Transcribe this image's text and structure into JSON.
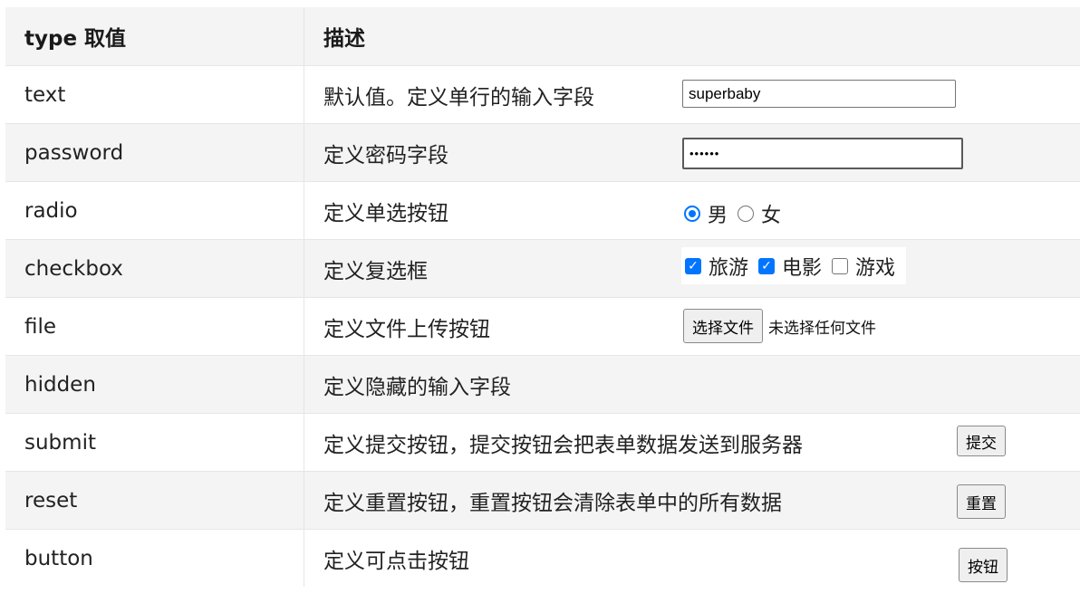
{
  "header": {
    "col_type": "type 取值",
    "col_desc": "描述"
  },
  "rows": [
    {
      "type": "text",
      "desc": "默认值。定义单行的输入字段",
      "value": "superbaby"
    },
    {
      "type": "password",
      "desc": "定义密码字段",
      "masked_value": "••••••"
    },
    {
      "type": "radio",
      "desc": "定义单选按钮",
      "options": [
        {
          "label": "男",
          "checked": true
        },
        {
          "label": "女",
          "checked": false
        }
      ]
    },
    {
      "type": "checkbox",
      "desc": "定义复选框",
      "options": [
        {
          "label": "旅游",
          "checked": true
        },
        {
          "label": "电影",
          "checked": true
        },
        {
          "label": "游戏",
          "checked": false
        }
      ]
    },
    {
      "type": "file",
      "desc": "定义文件上传按钮",
      "button_label": "选择文件",
      "status": "未选择任何文件"
    },
    {
      "type": "hidden",
      "desc": "定义隐藏的输入字段"
    },
    {
      "type": "submit",
      "desc": "定义提交按钮，提交按钮会把表单数据发送到服务器",
      "button_label": "提交"
    },
    {
      "type": "reset",
      "desc": "定义重置按钮，重置按钮会清除表单中的所有数据",
      "button_label": "重置"
    },
    {
      "type": "button",
      "desc": "定义可点击按钮",
      "button_label": "按钮"
    }
  ],
  "colors": {
    "header_bg": "#f4f4f4",
    "row_alt_bg": "#f4f4f4",
    "accent": "#0075ff",
    "border": "#e6e6e6"
  }
}
